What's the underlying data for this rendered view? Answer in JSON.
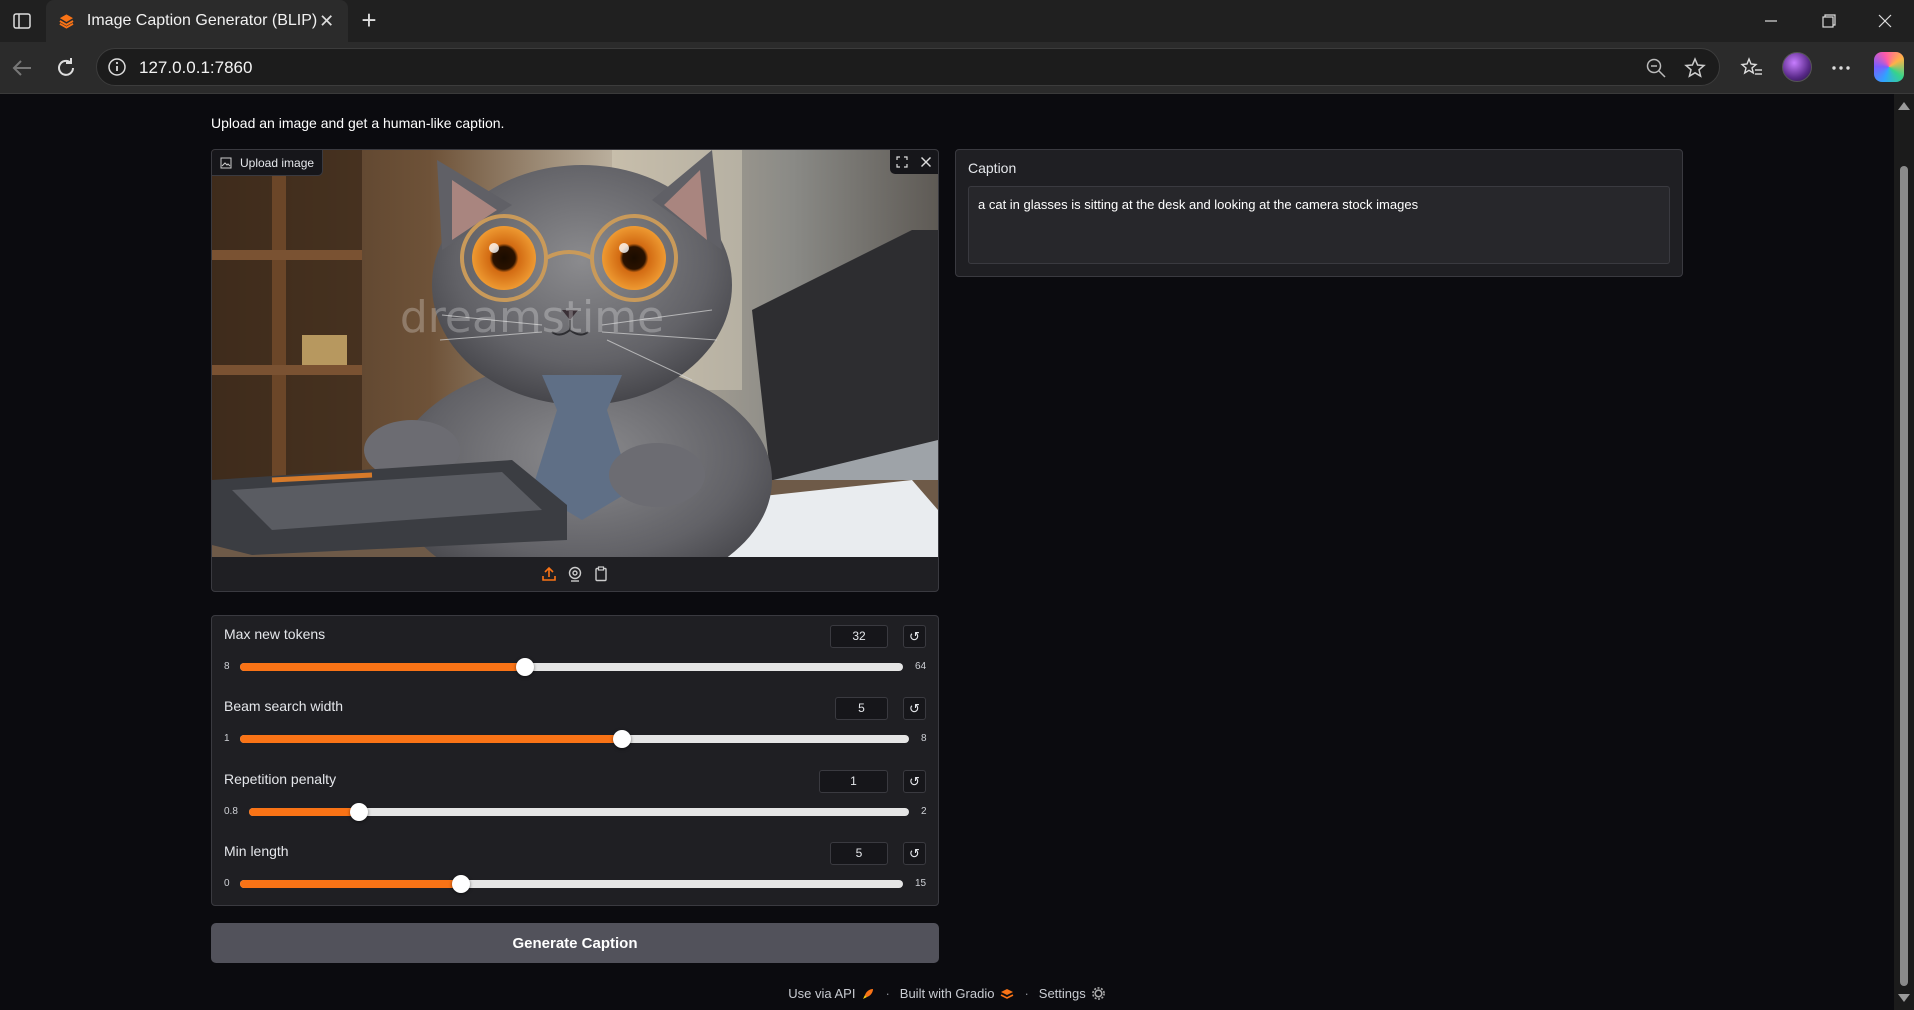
{
  "browser": {
    "tab_title": "Image Caption Generator (BLIP)",
    "url": "127.0.0.1:7860"
  },
  "page": {
    "intro": "Upload an image and get a human-like caption.",
    "image": {
      "label": "Upload image",
      "watermark": "dreamstime"
    },
    "sliders": [
      {
        "label": "Max new tokens",
        "value": "32",
        "min": "8",
        "max": "64"
      },
      {
        "label": "Beam search width",
        "value": "5",
        "min": "1",
        "max": "8"
      },
      {
        "label": "Repetition penalty",
        "value": "1",
        "min": "0.8",
        "max": "2"
      },
      {
        "label": "Min length",
        "value": "5",
        "min": "0",
        "max": "15"
      }
    ],
    "generate_label": "Generate Caption",
    "caption": {
      "label": "Caption",
      "value": "a cat in glasses is sitting at the desk and looking at the camera stock images"
    },
    "footer": {
      "api": "Use via API",
      "built": "Built with Gradio",
      "settings": "Settings"
    }
  },
  "colors": {
    "accent": "#f97316",
    "panel": "#1f1f23",
    "button": "#52525b"
  }
}
